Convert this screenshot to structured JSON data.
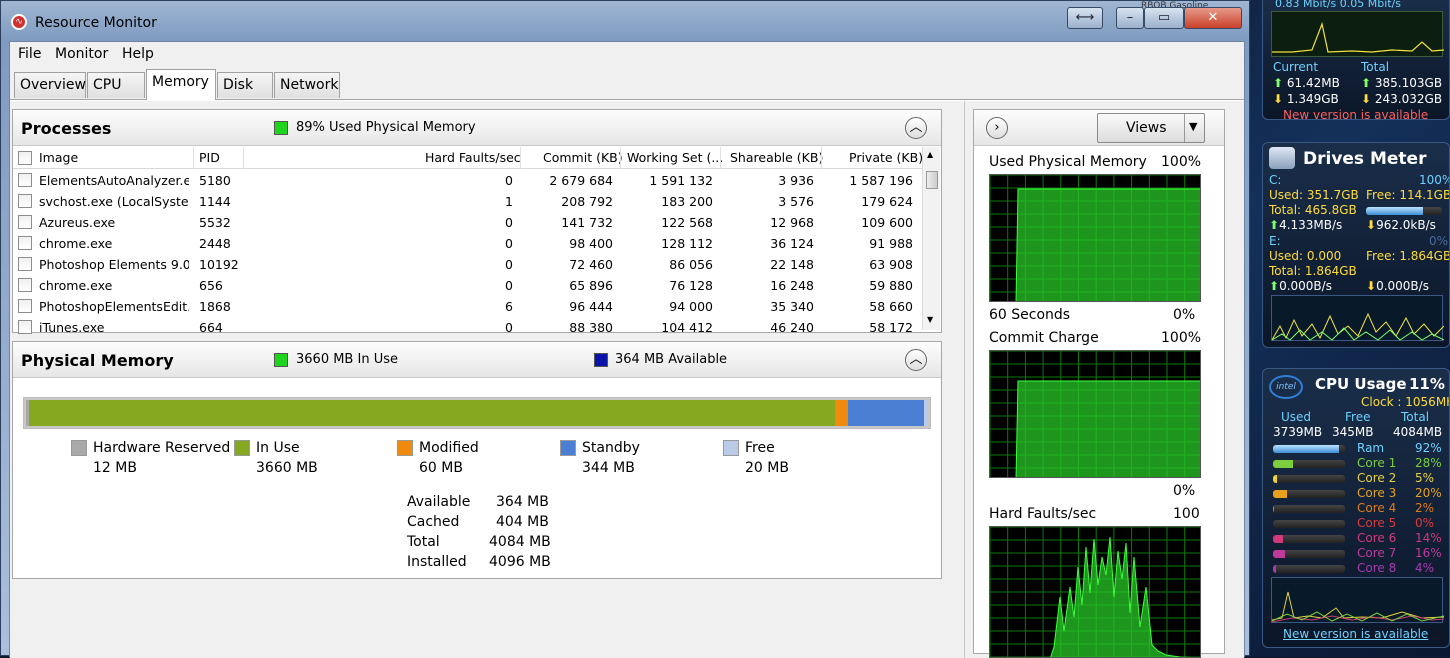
{
  "window": {
    "title": "Resource Monitor",
    "corner_tag": "RBOB Gasoline"
  },
  "menu": [
    "File",
    "Monitor",
    "Help"
  ],
  "tabs": [
    "Overview",
    "CPU",
    "Memory",
    "Disk",
    "Network"
  ],
  "active_tab": "Memory",
  "processes": {
    "title": "Processes",
    "usage_label": "89% Used Physical Memory",
    "columns": [
      "Image",
      "PID",
      "Hard Faults/sec",
      "Commit (KB)",
      "Working Set (...",
      "Shareable (KB)",
      "Private (KB)"
    ],
    "rows": [
      [
        "ElementsAutoAnalyzer.exe",
        "5180",
        "0",
        "2 679 684",
        "1 591 132",
        "3 936",
        "1 587 196"
      ],
      [
        "svchost.exe (LocalSyste...",
        "1144",
        "1",
        "208 792",
        "183 200",
        "3 576",
        "179 624"
      ],
      [
        "Azureus.exe",
        "5532",
        "0",
        "141 732",
        "122 568",
        "12 968",
        "109 600"
      ],
      [
        "chrome.exe",
        "2448",
        "0",
        "98 400",
        "128 112",
        "36 124",
        "91 988"
      ],
      [
        "Photoshop Elements 9.0...",
        "10192",
        "0",
        "72 460",
        "86 056",
        "22 148",
        "63 908"
      ],
      [
        "chrome.exe",
        "656",
        "0",
        "65 896",
        "76 128",
        "16 248",
        "59 880"
      ],
      [
        "PhotoshopElementsEdit...",
        "1868",
        "6",
        "96 444",
        "94 000",
        "35 340",
        "58 660"
      ],
      [
        "iTunes.exe",
        "664",
        "0",
        "88 380",
        "104 412",
        "46 240",
        "58 172"
      ]
    ]
  },
  "physical_memory": {
    "title": "Physical Memory",
    "in_use_label": "3660 MB In Use",
    "available_label": "364 MB Available",
    "bar": {
      "reserved_mb": 12,
      "in_use_mb": 3660,
      "modified_mb": 60,
      "standby_mb": 344,
      "free_mb": 20,
      "total_mb": 4096
    },
    "legend": [
      {
        "label": "Hardware Reserved",
        "value": "12 MB",
        "color": "#a9a9a9"
      },
      {
        "label": "In Use",
        "value": "3660 MB",
        "color": "#85a820"
      },
      {
        "label": "Modified",
        "value": "60 MB",
        "color": "#f08a0c"
      },
      {
        "label": "Standby",
        "value": "344 MB",
        "color": "#4a7fd4"
      },
      {
        "label": "Free",
        "value": "20 MB",
        "color": "#b9cbe6"
      }
    ],
    "stats": [
      {
        "label": "Available",
        "value": "364 MB"
      },
      {
        "label": "Cached",
        "value": "404 MB"
      },
      {
        "label": "Total",
        "value": "4084 MB"
      },
      {
        "label": "Installed",
        "value": "4096 MB"
      }
    ]
  },
  "graphs": {
    "views_label": "Views",
    "used_physical": {
      "label": "Used Physical Memory",
      "max": "100%",
      "time": "60 Seconds",
      "min": "0%"
    },
    "commit": {
      "label": "Commit Charge",
      "max": "100%",
      "min": "0%"
    },
    "hard_faults": {
      "label": "Hard Faults/sec",
      "max": "100"
    }
  },
  "gadgets": {
    "network": {
      "top_line": "0.83 Mbit/s   0.05 Mbit/s",
      "current_label": "Current",
      "total_label": "Total",
      "current_up": "61.42MB",
      "current_down": "1.349GB",
      "total_up": "385.103GB",
      "total_down": "243.032GB",
      "new_version": "New version is available"
    },
    "drives": {
      "title": "Drives Meter",
      "c_label": "C:",
      "c_pct": "100%",
      "c_used": "Used: 351.7GB",
      "c_free": "Free: 114.1GB",
      "c_total": "Total: 465.8GB",
      "c_fill": 0.75,
      "c_read": "4.133MB/s",
      "c_write": "962.0kB/s",
      "e_label": "E:",
      "e_pct": "0%",
      "e_used": "Used: 0.000",
      "e_free": "Free: 1.864GB",
      "e_total": "Total: 1.864GB",
      "e_read": "0.000B/s",
      "e_write": "0.000B/s"
    },
    "cpu": {
      "title": "CPU Usage",
      "pct": "11%",
      "clock": "Clock : 1056MHz",
      "used_label": "Used",
      "free_label": "Free",
      "total_label": "Total",
      "used": "3739MB",
      "free": "345MB",
      "total": "4084MB",
      "ram_label": "Ram",
      "ram_pct": "92%",
      "cores": [
        {
          "label": "Core 1",
          "pct": "28%",
          "fill": 0.28,
          "color": "#7ccf3c"
        },
        {
          "label": "Core 2",
          "pct": "5%",
          "fill": 0.05,
          "color": "#e8d23a"
        },
        {
          "label": "Core 3",
          "pct": "20%",
          "fill": 0.2,
          "color": "#e8a11c"
        },
        {
          "label": "Core 4",
          "pct": "2%",
          "fill": 0.02,
          "color": "#e07a1c"
        },
        {
          "label": "Core 5",
          "pct": "0%",
          "fill": 0.0,
          "color": "#d83a3a"
        },
        {
          "label": "Core 6",
          "pct": "14%",
          "fill": 0.14,
          "color": "#d03a7a"
        },
        {
          "label": "Core 7",
          "pct": "16%",
          "fill": 0.16,
          "color": "#c03a9a"
        },
        {
          "label": "Core 8",
          "pct": "4%",
          "fill": 0.04,
          "color": "#a83ab0"
        }
      ],
      "new_version": "New version is available"
    }
  }
}
